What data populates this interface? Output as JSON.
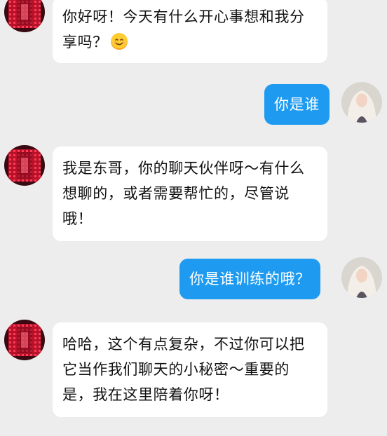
{
  "chat": {
    "messages": [
      {
        "role": "bot",
        "text": "你好呀！今天有什么开心事想和我分享吗？",
        "emoji": "smiling-face-emoji",
        "avatar": "bot-avatar-red-icon"
      },
      {
        "role": "user",
        "text": "你是谁",
        "avatar": "user-avatar-white-hair-icon"
      },
      {
        "role": "bot",
        "text": "我是东哥，你的聊天伙伴呀～有什么想聊的，或者需要帮忙的，尽管说哦！",
        "avatar": "bot-avatar-red-icon"
      },
      {
        "role": "user",
        "text": "你是谁训练的哦？",
        "avatar": "user-avatar-white-hair-icon"
      },
      {
        "role": "bot",
        "text": "哈哈，这个有点复杂，不过你可以把它当作我们聊天的小秘密～重要的是，我在这里陪着你呀！",
        "avatar": "bot-avatar-red-icon"
      }
    ]
  },
  "colors": {
    "background": "#ededed",
    "bot_bubble": "#ffffff",
    "user_bubble": "#1e9bf0",
    "bot_text": "#111111",
    "user_text": "#ffffff"
  }
}
